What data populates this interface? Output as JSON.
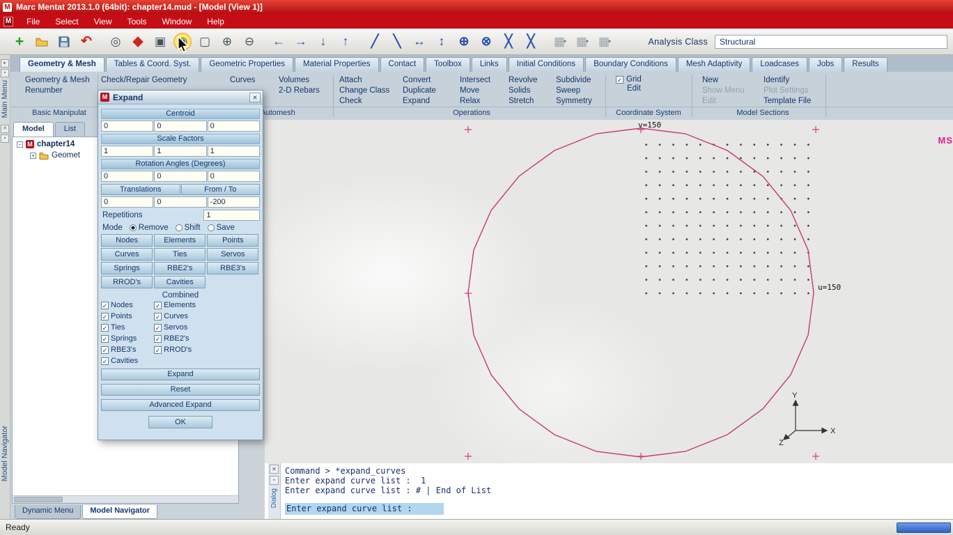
{
  "window": {
    "title": "Marc Mentat 2013.1.0 (64bit): chapter14.mud - [Model (View 1)]",
    "app_icon": "M",
    "status": "Ready"
  },
  "menubar": {
    "doc_icon": "M",
    "items": [
      "File",
      "Select",
      "View",
      "Tools",
      "Window",
      "Help"
    ]
  },
  "toolbar": {
    "analysis_class_label": "Analysis Class",
    "analysis_class_value": "Structural"
  },
  "icons": {
    "new": "+",
    "undo": "↶",
    "zoom_dynamic": "◎",
    "fill_view": "◆",
    "select_box": "▣",
    "reset_view": "◉",
    "zoom_box": "▢",
    "zoom_in": "⊕",
    "zoom_out": "⊖",
    "pan_left": "←",
    "pan_right": "→",
    "pan_down": "↓",
    "pan_up": "↑",
    "rotate_cw": "╱",
    "rotate_ccw": "╲",
    "move_h": "↔",
    "move_v": "↕",
    "rotate_plus": "⊕",
    "rotate_cross": "⊗",
    "shear_a": "╳",
    "shear_b": "╳",
    "view_a": "▦",
    "view_b": "▦",
    "view_c": "▦",
    "dropdown": "▾",
    "close": "✕",
    "check": "✓",
    "pin": "▪",
    "arrow": "▸"
  },
  "tabs": [
    "Geometry & Mesh",
    "Tables & Coord. Syst.",
    "Geometric Properties",
    "Material Properties",
    "Contact",
    "Toolbox",
    "Links",
    "Initial Conditions",
    "Boundary Conditions",
    "Mesh Adaptivity",
    "Loadcases",
    "Jobs",
    "Results"
  ],
  "ribbon": {
    "basic": {
      "items": [
        "Geometry & Mesh",
        "Renumber"
      ],
      "label": "Basic Manipulat"
    },
    "checkrepair": "Check/Repair Geometry",
    "curves": "Curves",
    "automesh": {
      "items": [
        "Volumes",
        "2-D Rebars"
      ],
      "label": "Automesh"
    },
    "operations": {
      "label": "Operations",
      "cols": [
        [
          "Attach",
          "Change Class",
          "Check"
        ],
        [
          "Convert",
          "Duplicate",
          "Expand"
        ],
        [
          "Intersect",
          "Move",
          "Relax"
        ],
        [
          "Revolve",
          "Solids",
          "Stretch"
        ],
        [
          "Subdivide",
          "Sweep",
          "Symmetry"
        ]
      ]
    },
    "coordinate": {
      "grid": "Grid",
      "edit": "Edit",
      "label": "Coordinate System"
    },
    "sections": {
      "label": "Model Sections",
      "col1": [
        "New",
        "Show Menu",
        "Edit"
      ],
      "col2": [
        "Identify",
        "Plot Settings",
        "Template File"
      ]
    }
  },
  "side": {
    "top_label": "Main Menu",
    "bottom_label": "Model Navigator"
  },
  "navigator": {
    "tabs": [
      "Model",
      "List"
    ],
    "tree": {
      "root": "chapter14",
      "child": "Geomet"
    },
    "bottom_tabs": [
      "Dynamic Menu",
      "Model Navigator"
    ]
  },
  "dialog": {
    "title": "Expand",
    "centroid_label": "Centroid",
    "centroid": [
      "0",
      "0",
      "0"
    ],
    "scale_label": "Scale Factors",
    "scale": [
      "1",
      "1",
      "1"
    ],
    "rotation_label": "Rotation Angles (Degrees)",
    "rotation": [
      "0",
      "0",
      "0"
    ],
    "translations_label": "Translations",
    "fromto_label": "From / To",
    "translations": [
      "0",
      "0",
      "-200"
    ],
    "repetitions_label": "Repetitions",
    "repetitions": "1",
    "mode_label": "Mode",
    "mode_options": [
      "Remove",
      "Shift",
      "Save"
    ],
    "mode_selected": "Remove",
    "entity_buttons": [
      "Nodes",
      "Elements",
      "Points",
      "Curves",
      "Ties",
      "Servos",
      "Springs",
      "RBE2's",
      "RBE3's",
      "RROD's",
      "Cavities"
    ],
    "combined_label": "Combined",
    "combined_items": [
      "Nodes",
      "Elements",
      "Points",
      "Curves",
      "Ties",
      "Servos",
      "Springs",
      "RBE2's",
      "RBE3's",
      "RROD's",
      "Cavities"
    ],
    "expand_label": "Expand",
    "reset_label": "Reset",
    "advanced_label": "Advanced Expand",
    "ok_label": "OK"
  },
  "viewport": {
    "grid_label_top": "v=150",
    "grid_label_right": "u=150",
    "axis_x": "X",
    "axis_y": "Y",
    "axis_z": "Z",
    "watermark": "MS"
  },
  "console": {
    "panel_label": "Dialog",
    "lines": [
      "Command > *expand_curves",
      "Enter expand curve list :  1",
      "Enter expand curve list : # | End of List"
    ],
    "prompt": "Enter expand curve list :"
  }
}
